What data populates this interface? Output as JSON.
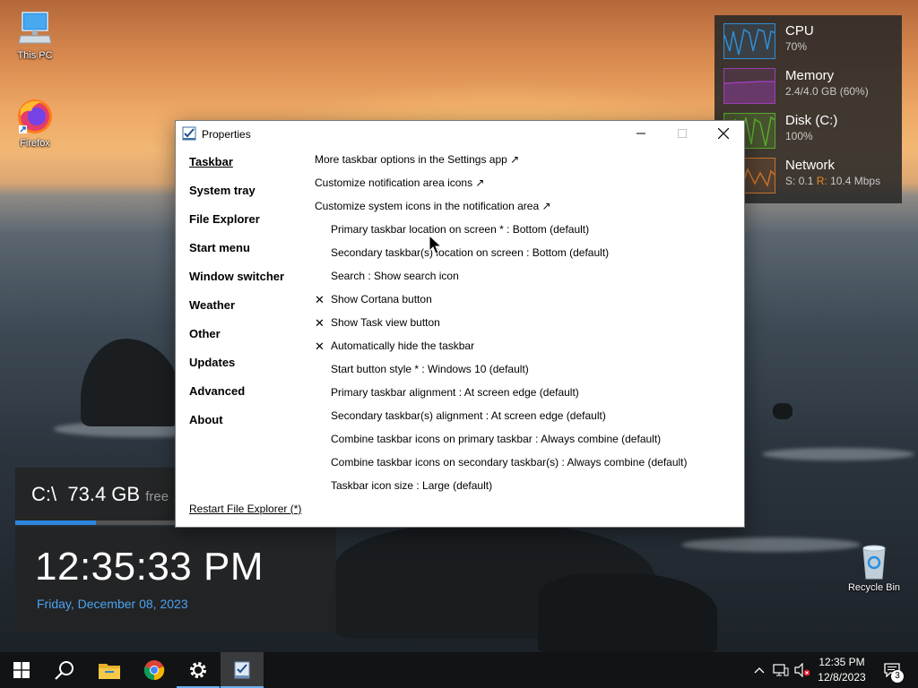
{
  "desktop": {
    "icons": [
      {
        "label": "This PC",
        "icon": "computer-icon"
      },
      {
        "label": "Firefox",
        "icon": "firefox-icon"
      },
      {
        "label": "Recycle Bin",
        "icon": "recycle-bin-icon"
      }
    ]
  },
  "perf_widget": {
    "cpu": {
      "name": "CPU",
      "value": "70%",
      "color": "#2f8fd6"
    },
    "memory": {
      "name": "Memory",
      "value": "2.4/4.0 GB (60%)",
      "color": "#9b3fb5"
    },
    "disk": {
      "name": "Disk (C:)",
      "value": "100%",
      "color": "#5aa92c"
    },
    "network": {
      "name": "Network",
      "send_label": "S:",
      "send": "0.1",
      "recv_label": "R:",
      "recv": "10.4 Mbps",
      "color": "#c8742c"
    }
  },
  "disk_widget": {
    "drive": "C:\\",
    "size": "73.4 GB",
    "suffix": "free",
    "usage_fraction": 0.5
  },
  "clock_widget": {
    "time": "12:35:33 PM",
    "date": "Friday, December 08, 2023"
  },
  "window": {
    "title": "Properties",
    "nav": [
      {
        "label": "Taskbar",
        "active": true
      },
      {
        "label": "System tray"
      },
      {
        "label": "File Explorer"
      },
      {
        "label": "Start menu"
      },
      {
        "label": "Window switcher"
      },
      {
        "label": "Weather"
      },
      {
        "label": "Other"
      },
      {
        "label": "Updates"
      },
      {
        "label": "Advanced"
      },
      {
        "label": "About"
      }
    ],
    "restart_link": "Restart File Explorer (*)",
    "links": [
      "More taskbar options in the Settings app ↗",
      "Customize notification area icons ↗",
      "Customize system icons in the notification area ↗"
    ],
    "options": [
      {
        "text": "Primary taskbar location on screen * : Bottom (default)",
        "mark": ""
      },
      {
        "text": "Secondary taskbar(s) location on screen : Bottom (default)",
        "mark": ""
      },
      {
        "text": "Search : Show search icon",
        "mark": ""
      },
      {
        "text": "Show Cortana button",
        "mark": "✕"
      },
      {
        "text": "Show Task view button",
        "mark": "✕"
      },
      {
        "text": "Automatically hide the taskbar",
        "mark": "✕"
      },
      {
        "text": "Start button style * : Windows 10 (default)",
        "mark": ""
      },
      {
        "text": "Primary taskbar alignment : At screen edge (default)",
        "mark": ""
      },
      {
        "text": "Secondary taskbar(s) alignment : At screen edge (default)",
        "mark": ""
      },
      {
        "text": "Combine taskbar icons on primary taskbar : Always combine (default)",
        "mark": ""
      },
      {
        "text": "Combine taskbar icons on secondary taskbar(s) : Always combine (default)",
        "mark": ""
      },
      {
        "text": "Taskbar icon size : Large (default)",
        "mark": ""
      }
    ]
  },
  "taskbar": {
    "pinned": [
      "windows-start-icon",
      "search-icon",
      "file-explorer-icon",
      "chrome-icon",
      "settings-gear-icon",
      "properties-app-icon"
    ],
    "clock_time": "12:35 PM",
    "clock_date": "12/8/2023",
    "notification_count": "3"
  }
}
